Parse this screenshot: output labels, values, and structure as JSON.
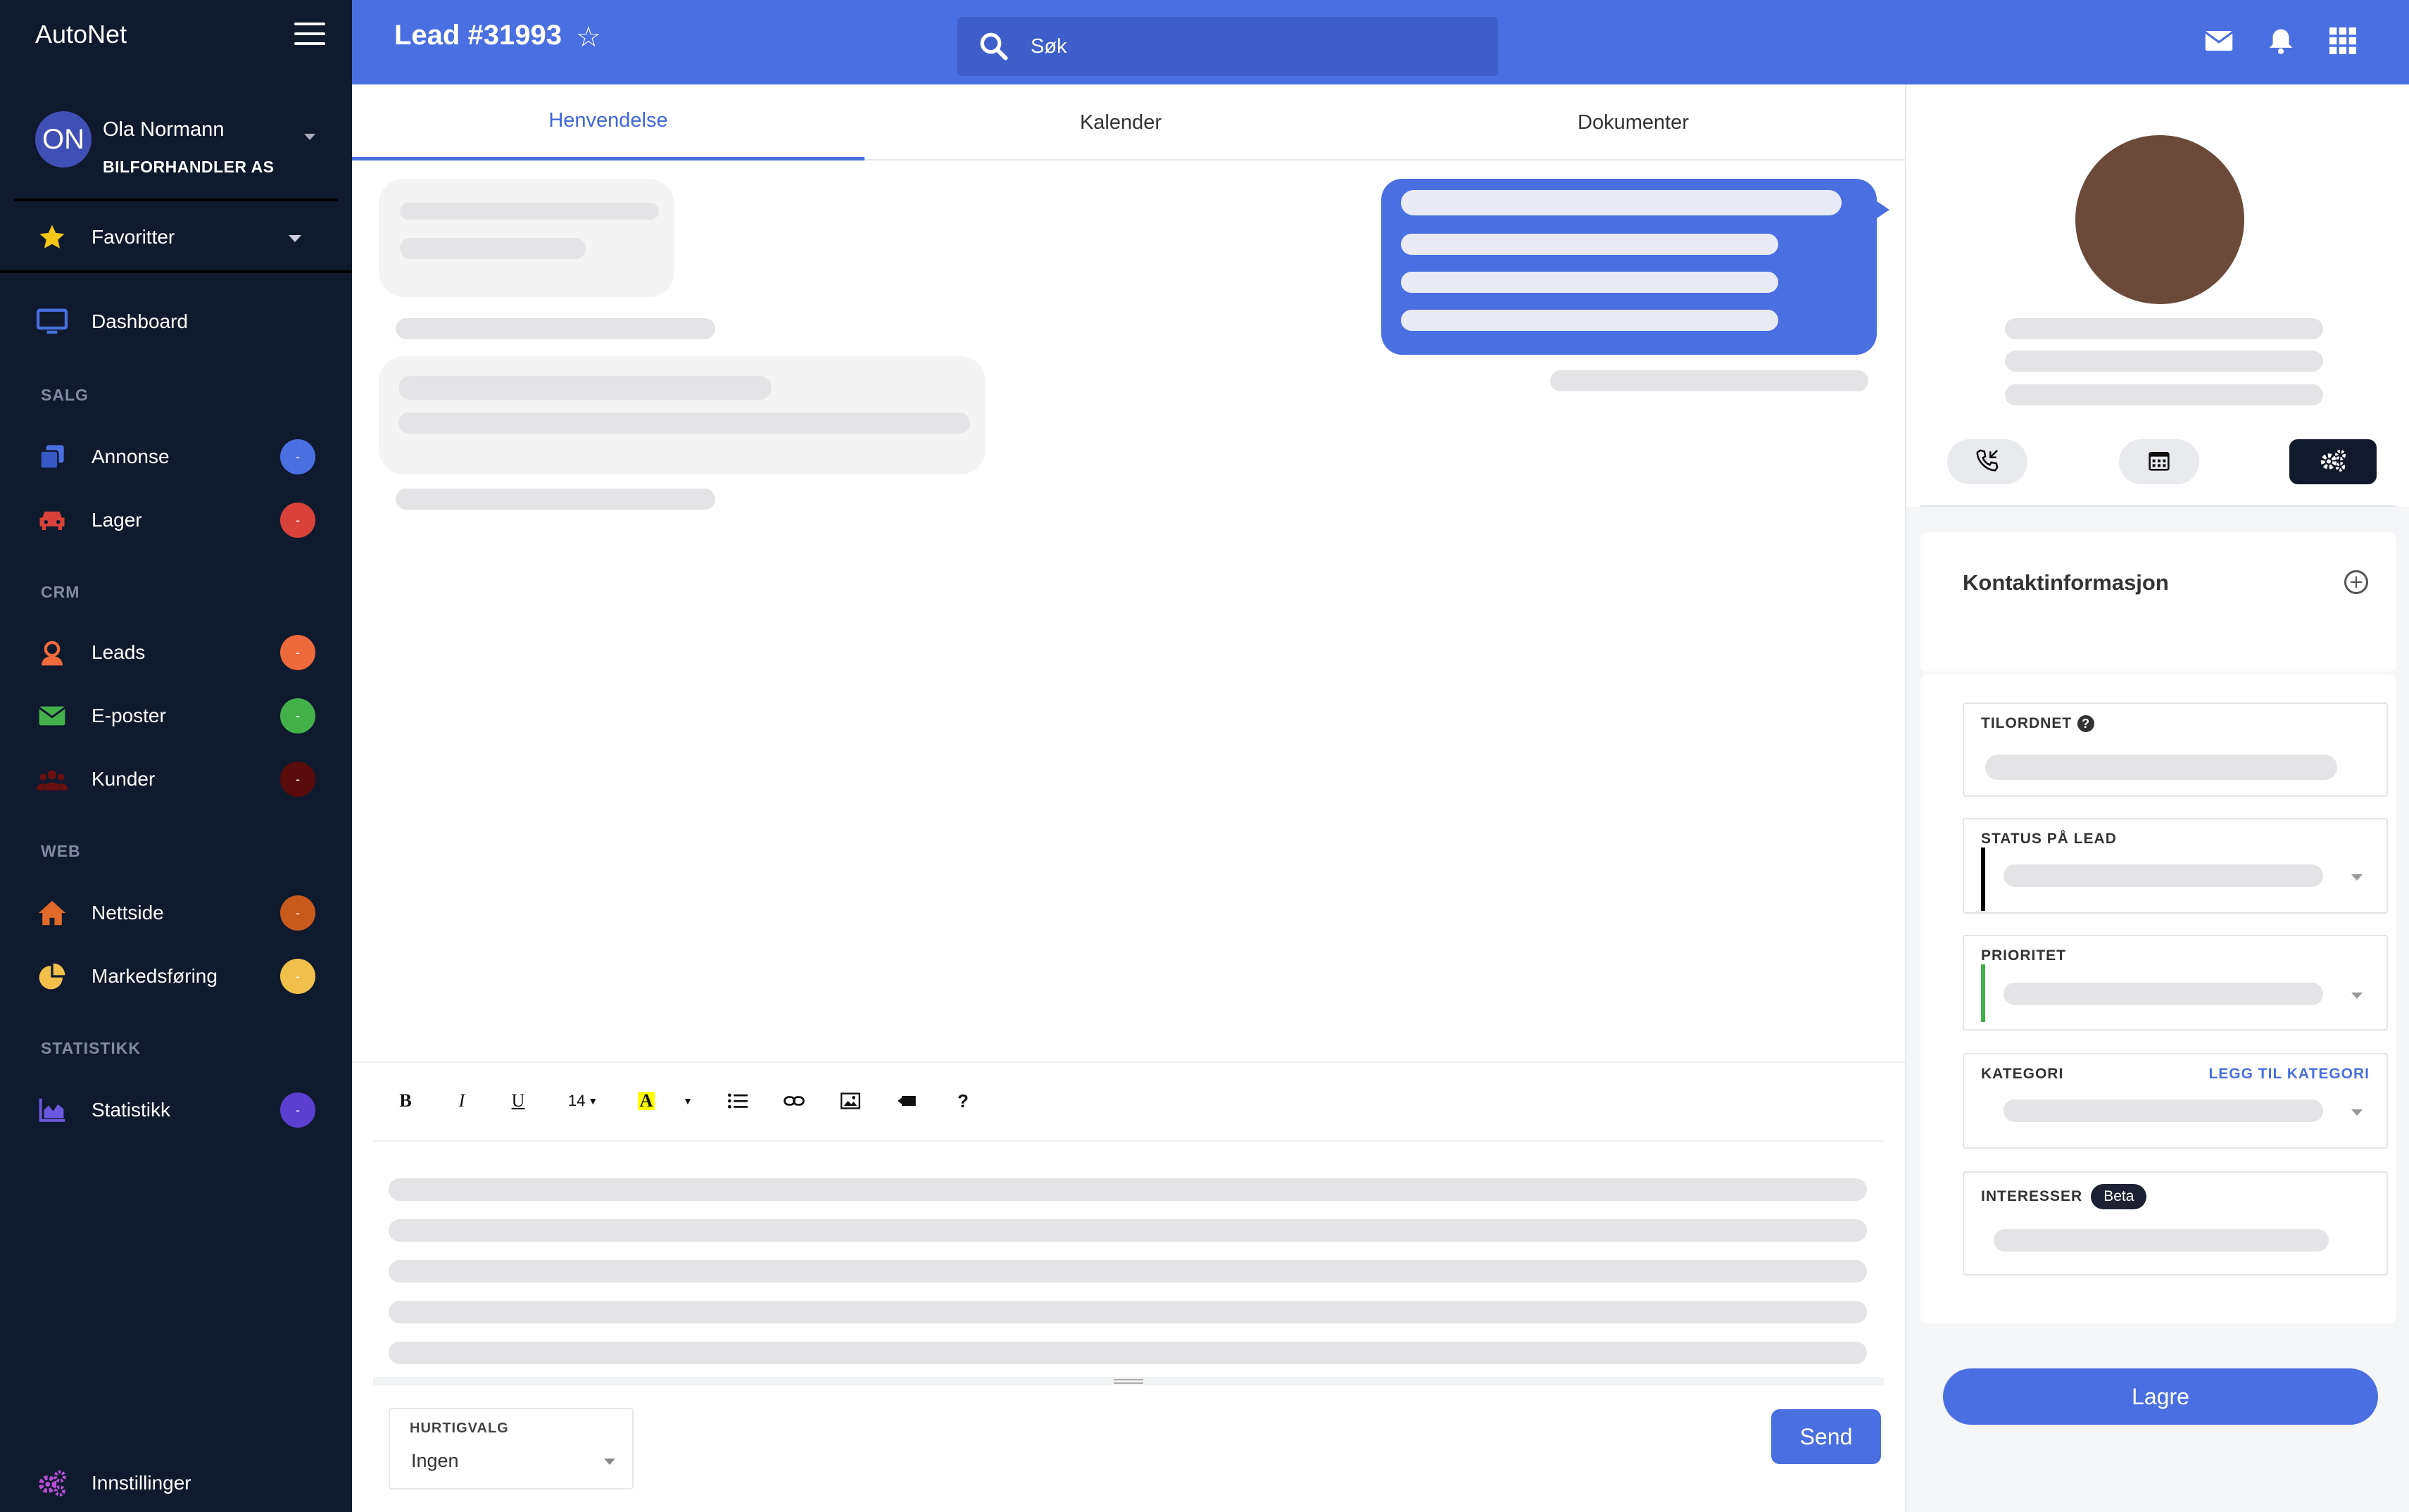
{
  "app": {
    "brand": "AutoNet"
  },
  "user": {
    "initials": "ON",
    "name": "Ola Normann",
    "company": "BILFORHANDLER AS"
  },
  "sidebar": {
    "favorites_label": "Favoritter",
    "dashboard_label": "Dashboard",
    "sections": [
      {
        "title": "SALG",
        "items": [
          {
            "label": "Annonse",
            "badge": "-",
            "color": "#4a6fe0",
            "icon": "copy-icon"
          },
          {
            "label": "Lager",
            "badge": "-",
            "color": "#d9423a",
            "icon": "car-icon"
          }
        ]
      },
      {
        "title": "CRM",
        "items": [
          {
            "label": "Leads",
            "badge": "-",
            "color": "#ee6a3c",
            "icon": "user-headset-icon"
          },
          {
            "label": "E-poster",
            "badge": "-",
            "color": "#43b04a",
            "icon": "envelope-icon"
          },
          {
            "label": "Kunder",
            "badge": "-",
            "color": "#5a0b0b",
            "icon": "users-icon"
          }
        ]
      },
      {
        "title": "WEB",
        "items": [
          {
            "label": "Nettside",
            "badge": "-",
            "color": "#c85a1e",
            "icon": "home-icon"
          },
          {
            "label": "Markedsføring",
            "badge": "-",
            "color": "#f0c04a",
            "icon": "pie-chart-icon"
          }
        ]
      },
      {
        "title": "STATISTIKK",
        "items": [
          {
            "label": "Statistikk",
            "badge": "-",
            "color": "#5b3fd0",
            "icon": "area-chart-icon"
          }
        ]
      }
    ],
    "settings_label": "Innstillinger"
  },
  "header": {
    "title": "Lead #31993",
    "search_placeholder": "Søk"
  },
  "tabs": [
    {
      "label": "Henvendelse",
      "active": true
    },
    {
      "label": "Kalender",
      "active": false
    },
    {
      "label": "Dokumenter",
      "active": false
    }
  ],
  "editor": {
    "font_size": "14",
    "quick_label": "HURTIGVALG",
    "quick_value": "Ingen",
    "send_label": "Send"
  },
  "right_panel": {
    "contact_title": "Kontaktinformasjon",
    "fields": {
      "assigned_label": "TILORDNET",
      "status_label": "STATUS PÅ LEAD",
      "priority_label": "PRIORITET",
      "category_label": "KATEGORI",
      "category_link": "LEGG TIL KATEGORI",
      "interests_label": "INTERESSER",
      "beta_label": "Beta"
    },
    "save_label": "Lagre"
  },
  "colors": {
    "accent": "#4a6fe0",
    "sidebar_bg": "#101a2e",
    "profile": "#6b4a3a",
    "priority": "#43b04a",
    "status": "#000000"
  }
}
